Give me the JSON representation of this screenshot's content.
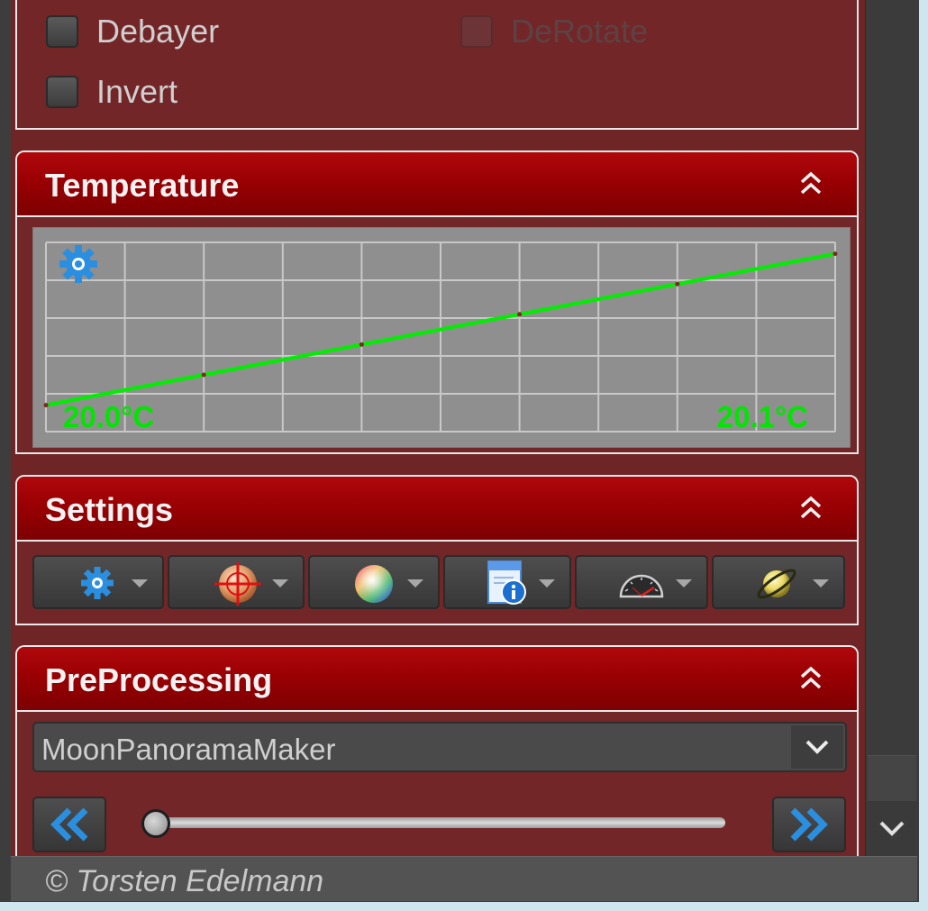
{
  "options": {
    "debayer": "Debayer",
    "derotate": "DeRotate",
    "invert": "Invert"
  },
  "temperature": {
    "title": "Temperature",
    "start_label": "20.0°C",
    "end_label": "20.1°C",
    "line_color": "#00ee00",
    "readings": [
      20.0,
      20.02,
      20.04,
      20.06,
      20.08,
      20.1
    ]
  },
  "settings": {
    "title": "Settings",
    "tools": [
      {
        "icon": "gear-icon"
      },
      {
        "icon": "crosshair-planet-icon"
      },
      {
        "icon": "color-wheel-icon"
      },
      {
        "icon": "info-document-icon"
      },
      {
        "icon": "gauge-icon"
      },
      {
        "icon": "saturn-icon"
      }
    ]
  },
  "preprocessing": {
    "title": "PreProcessing",
    "selected_script": "MoonPanoramaMaker",
    "slider_position": 0
  },
  "footer": {
    "copyright": "© Torsten Edelmann"
  },
  "colors": {
    "panel_bg": "#732628",
    "header_red": "#9a0003",
    "graph_line": "#00ee00",
    "accent_blue": "#2a8fe0"
  }
}
